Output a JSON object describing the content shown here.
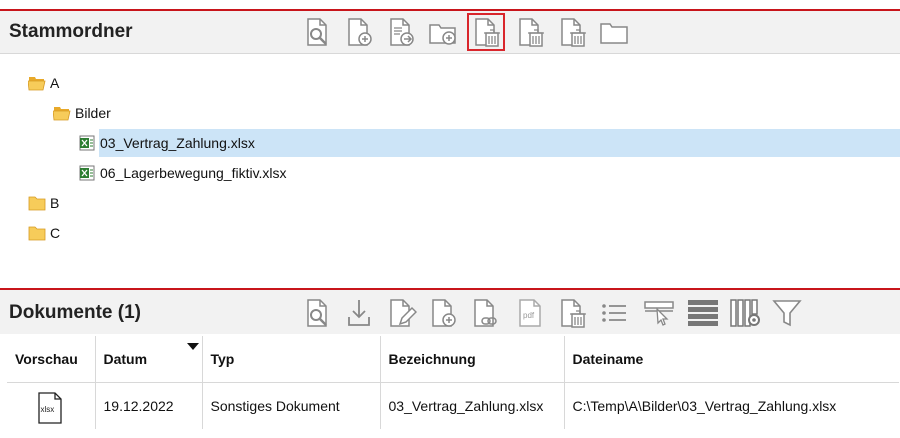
{
  "colors": {
    "accent": "#c8151b",
    "selection": "#cce4f7",
    "header_bg": "#f2f2f2",
    "excel_green": "#2e7d32",
    "folder": "#f4c045"
  },
  "root_panel": {
    "title": "Stammordner",
    "toolbar": [
      {
        "icon": "view-document-icon"
      },
      {
        "icon": "add-document-icon"
      },
      {
        "icon": "move-document-icon"
      },
      {
        "icon": "add-folder-icon"
      },
      {
        "icon": "delete-document-icon",
        "active": true
      },
      {
        "icon": "delete-document-icon-2"
      },
      {
        "icon": "delete-document-icon-3"
      },
      {
        "icon": "folder-icon"
      }
    ]
  },
  "tree": [
    {
      "label": "A",
      "type": "folder-open",
      "level": 0
    },
    {
      "label": "Bilder",
      "type": "folder-open",
      "level": 1
    },
    {
      "label": "03_Vertrag_Zahlung.xlsx",
      "type": "excel",
      "level": 2,
      "selected": true
    },
    {
      "label": "06_Lagerbewegung_fiktiv.xlsx",
      "type": "excel",
      "level": 2
    },
    {
      "label": "B",
      "type": "folder",
      "level": 0
    },
    {
      "label": "C",
      "type": "folder",
      "level": 0
    }
  ],
  "documents_panel": {
    "title": "Dokumente (1)",
    "toolbar": [
      {
        "icon": "view-document-icon"
      },
      {
        "icon": "download-icon"
      },
      {
        "icon": "edit-document-icon"
      },
      {
        "icon": "add-document-icon"
      },
      {
        "icon": "link-document-icon"
      },
      {
        "icon": "pdf-icon",
        "text": "pdf"
      },
      {
        "icon": "delete-document-icon"
      },
      {
        "icon": "list-icon"
      },
      {
        "icon": "select-columns-icon"
      },
      {
        "icon": "rows-icon"
      },
      {
        "icon": "column-settings-icon"
      },
      {
        "icon": "filter-icon"
      }
    ]
  },
  "table": {
    "columns": [
      "Vorschau",
      "Datum",
      "Typ",
      "Bezeichnung",
      "Dateiname"
    ],
    "rows": [
      {
        "preview": "xlsx",
        "date": "19.12.2022",
        "type": "Sonstiges Dokument",
        "name": "03_Vertrag_Zahlung.xlsx",
        "file": "C:\\Temp\\A\\Bilder\\03_Vertrag_Zahlung.xlsx"
      }
    ]
  }
}
